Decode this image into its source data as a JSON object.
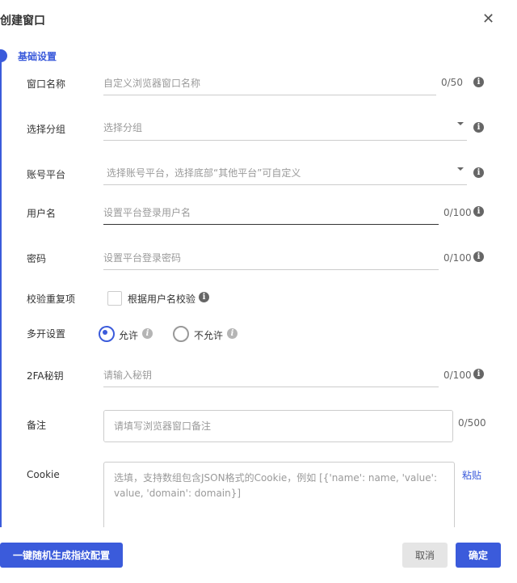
{
  "dialog": {
    "title": "创建窗口",
    "close_icon": "close-icon"
  },
  "section": {
    "title": "基础设置"
  },
  "fields": {
    "window_name": {
      "label": "窗口名称",
      "placeholder": "自定义浏览器窗口名称",
      "count": "0/50"
    },
    "group": {
      "label": "选择分组",
      "placeholder": "选择分组"
    },
    "platform": {
      "label": "账号平台",
      "placeholder": "选择账号平台，选择底部“其他平台”可自定义"
    },
    "username": {
      "label": "用户名",
      "placeholder": "设置平台登录用户名",
      "count": "0/100"
    },
    "password": {
      "label": "密码",
      "placeholder": "设置平台登录密码",
      "count": "0/100"
    },
    "dup_check": {
      "label": "校验重复项",
      "option": "根据用户名校验",
      "checked": false
    },
    "multi_open": {
      "label": "多开设置",
      "options": [
        "允许",
        "不允许"
      ],
      "selected": "允许"
    },
    "twofa": {
      "label": "2FA秘钥",
      "placeholder": "请输入秘钥",
      "count": "0/100"
    },
    "remark": {
      "label": "备注",
      "placeholder": "请填写浏览器窗口备注",
      "count": "0/500"
    },
    "cookie": {
      "label": "Cookie",
      "placeholder": "选填，支持数组包含JSON格式的Cookie，例如 [{'name': name, 'value': value, 'domain': domain}]",
      "paste": "粘贴"
    }
  },
  "footer": {
    "random_label": "一键随机生成指纹配置",
    "cancel_label": "取消",
    "ok_label": "确定"
  },
  "colors": {
    "accent": "#3b5bdb"
  }
}
